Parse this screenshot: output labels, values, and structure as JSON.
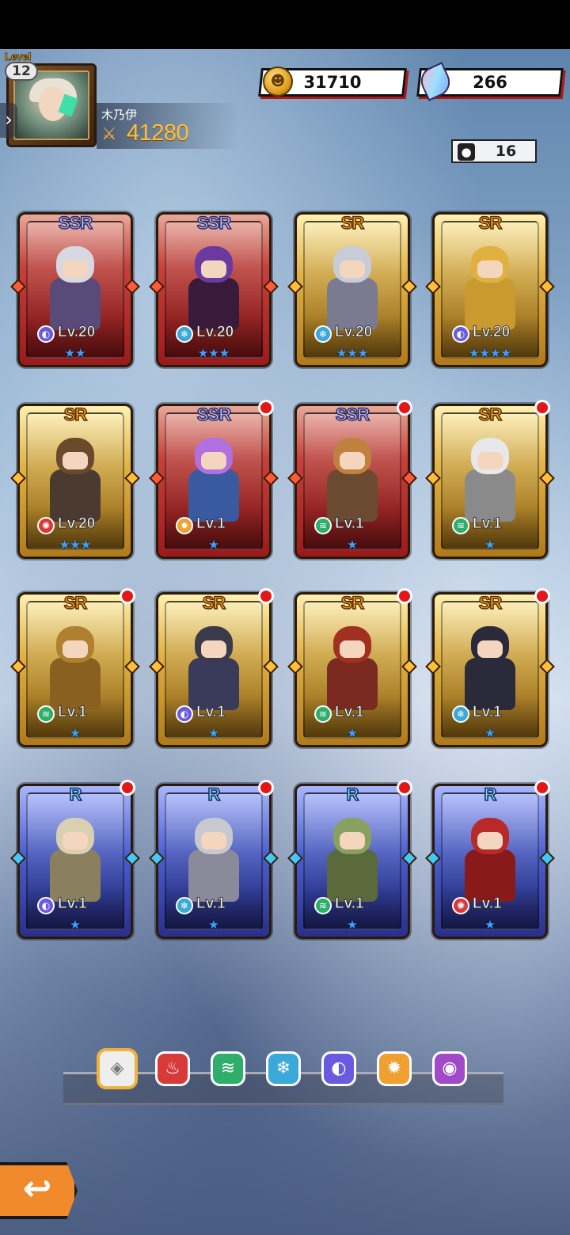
{
  "player": {
    "level_word": "Level",
    "level": "12",
    "name": "木乃伊",
    "power": "41280"
  },
  "currency": {
    "gold": "31710",
    "gems": "266"
  },
  "hero_count": "16",
  "cards": [
    {
      "rarity": "SSR",
      "level": "Lv.20",
      "stars": "★★",
      "element": "dark",
      "dot": false
    },
    {
      "rarity": "SSR",
      "level": "Lv.20",
      "stars": "★★★",
      "element": "ice",
      "dot": false
    },
    {
      "rarity": "SR",
      "level": "Lv.20",
      "stars": "★★★",
      "element": "ice",
      "dot": false
    },
    {
      "rarity": "SR",
      "level": "Lv.20",
      "stars": "★★★★",
      "element": "dark",
      "dot": false
    },
    {
      "rarity": "SR",
      "level": "Lv.20",
      "stars": "★★★",
      "element": "fire",
      "dot": false
    },
    {
      "rarity": "SSR",
      "level": "Lv.1",
      "stars": "★",
      "element": "light",
      "dot": true
    },
    {
      "rarity": "SSR",
      "level": "Lv.1",
      "stars": "★",
      "element": "wind",
      "dot": true
    },
    {
      "rarity": "SR",
      "level": "Lv.1",
      "stars": "★",
      "element": "wind",
      "dot": true
    },
    {
      "rarity": "SR",
      "level": "Lv.1",
      "stars": "★",
      "element": "wind",
      "dot": true
    },
    {
      "rarity": "SR",
      "level": "Lv.1",
      "stars": "★",
      "element": "dark",
      "dot": true
    },
    {
      "rarity": "SR",
      "level": "Lv.1",
      "stars": "★",
      "element": "wind",
      "dot": true
    },
    {
      "rarity": "SR",
      "level": "Lv.1",
      "stars": "★",
      "element": "ice",
      "dot": true
    },
    {
      "rarity": "R",
      "level": "Lv.1",
      "stars": "★",
      "element": "dark",
      "dot": true
    },
    {
      "rarity": "R",
      "level": "Lv.1",
      "stars": "★",
      "element": "ice",
      "dot": true
    },
    {
      "rarity": "R",
      "level": "Lv.1",
      "stars": "★",
      "element": "wind",
      "dot": true
    },
    {
      "rarity": "R",
      "level": "Lv.1",
      "stars": "★",
      "element": "fire",
      "dot": true
    }
  ],
  "element_colors": {
    "fire": "#d83a3a",
    "ice": "#3aa8d8",
    "wind": "#2eae6a",
    "dark": "#6a5ae0",
    "light": "#f0a030",
    "all": "#dddddd",
    "mystic": "#a04ac8"
  },
  "filters": [
    {
      "id": "all",
      "icon": "grid-icon",
      "color": "#e6e6e6"
    },
    {
      "id": "fire",
      "icon": "flame-icon",
      "color": "#d83a3a"
    },
    {
      "id": "wind",
      "icon": "wind-icon",
      "color": "#2eae6a"
    },
    {
      "id": "ice",
      "icon": "snowflake-icon",
      "color": "#3aa8d8"
    },
    {
      "id": "dark",
      "icon": "moon-icon",
      "color": "#6a5ae0"
    },
    {
      "id": "light",
      "icon": "sun-icon",
      "color": "#f0a030"
    },
    {
      "id": "mystic",
      "icon": "eye-icon",
      "color": "#a04ac8"
    }
  ]
}
